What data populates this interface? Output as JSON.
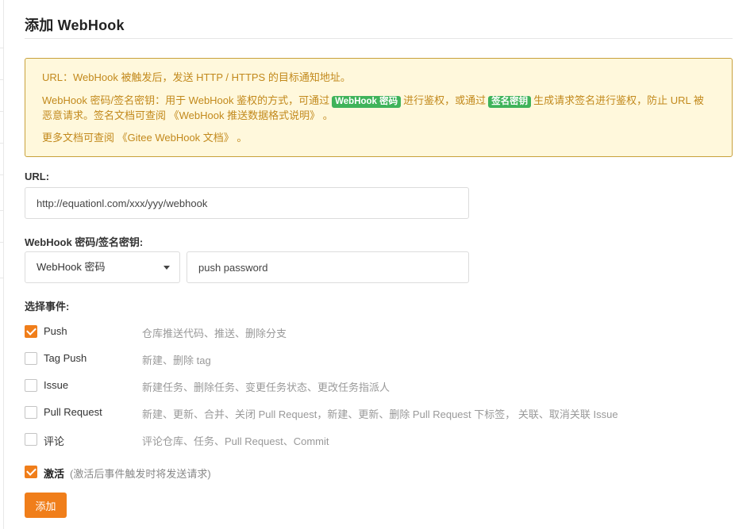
{
  "page": {
    "title": "添加 WebHook"
  },
  "notice": {
    "line1": "URL：WebHook 被触发后，发送 HTTP / HTTPS 的目标通知地址。",
    "line2_a": "WebHook 密码/签名密钥：用于 WebHook 鉴权的方式，可通过",
    "tag_password": "WebHook 密码",
    "line2_b": "进行鉴权，或通过",
    "tag_signature": "签名密钥",
    "line2_c": "生成请求签名进行鉴权，防止 URL 被恶意请求。签名文档可查阅",
    "link_push_doc": "《WebHook 推送数据格式说明》",
    "line2_end": "。",
    "line3_a": "更多文档可查阅",
    "link_gitee_doc": "《Gitee WebHook 文档》",
    "line3_end": "。",
    "colors": {
      "background": "#fff8dc",
      "border": "#c8a13c",
      "text": "#c2891c",
      "tag": "#3fb35a"
    }
  },
  "form": {
    "url_label": "URL:",
    "url_value": "http://equationl.com/xxx/yyy/webhook",
    "secret_label": "WebHook 密码/签名密钥:",
    "secret_type_selected": "WebHook 密码",
    "secret_value": "push password",
    "events_label": "选择事件:",
    "events": [
      {
        "name": "Push",
        "desc": "仓库推送代码、推送、删除分支",
        "checked": true
      },
      {
        "name": "Tag Push",
        "desc": "新建、删除 tag",
        "checked": false
      },
      {
        "name": "Issue",
        "desc": "新建任务、删除任务、变更任务状态、更改任务指派人",
        "checked": false
      },
      {
        "name": "Pull Request",
        "desc": "新建、更新、合并、关闭 Pull Request，新建、更新、删除 Pull Request 下标签， 关联、取消关联 Issue",
        "checked": false
      },
      {
        "name": "评论",
        "desc": "评论仓库、任务、Pull Request、Commit",
        "checked": false
      }
    ],
    "active_label": "激活",
    "active_hint": "(激活后事件触发时将发送请求)",
    "active_checked": true,
    "submit_label": "添加",
    "accent_color": "#f07e1a"
  }
}
